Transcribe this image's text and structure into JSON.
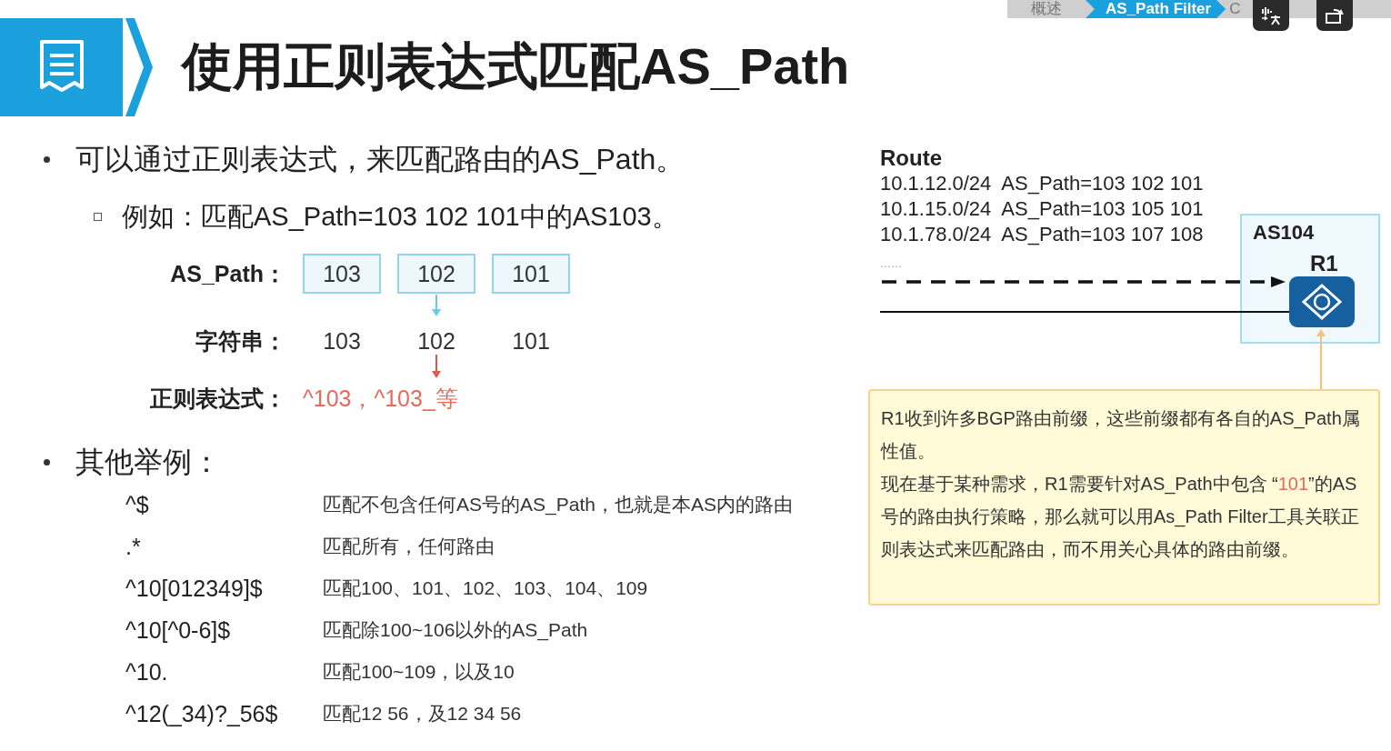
{
  "nav": [
    {
      "label": "概述",
      "selected": false
    },
    {
      "label": "AS_Path Filter",
      "selected": true
    },
    {
      "label": "C",
      "selected": false
    }
  ],
  "title": "使用正则表达式匹配AS_Path",
  "bullet": "可以通过正则表达式，来匹配路由的AS_Path。",
  "sub_bullet": "例如：匹配AS_Path=103 102 101中的AS103。",
  "example": {
    "as_path_label": "AS_Path：",
    "as_path": [
      "103",
      "102",
      "101"
    ],
    "string_label": "字符串：",
    "string": [
      "103",
      "102",
      "101"
    ],
    "regex_label": "正则表达式：",
    "regex": "^103，^103_等"
  },
  "other_bullet": "其他举例：",
  "examples": [
    {
      "pattern": "^$",
      "meaning": "匹配不包含任何AS号的AS_Path，也就是本AS内的路由"
    },
    {
      "pattern": ".*",
      "meaning": "匹配所有，任何路由"
    },
    {
      "pattern": "^10[012349]$",
      "meaning": "匹配100、101、102、103、104、109"
    },
    {
      "pattern": "^10[^0-6]$",
      "meaning": "匹配除100~106以外的AS_Path"
    },
    {
      "pattern": "^10.",
      "meaning": "匹配100~109，以及10"
    },
    {
      "pattern": "^12(_34)?_56$",
      "meaning": "匹配12 56，及12 34 56"
    }
  ],
  "diagram": {
    "route_title": "Route",
    "routes": [
      "10.1.12.0/24  AS_Path=103 102 101",
      "10.1.15.0/24  AS_Path=103 105 101",
      "10.1.78.0/24  AS_Path=103 107 108"
    ],
    "ellipsis": "……",
    "as_label": "AS104",
    "router_label": "R1"
  },
  "note": [
    [
      {
        "text": "R1收到许多BGP路由前缀，这些前缀都有各自的AS_Path属性值。",
        "highlight": false
      }
    ],
    [
      {
        "text": "现在基于某种需求，R1需要针对AS_Path中包含 “",
        "highlight": false
      },
      {
        "text": "101",
        "highlight": true
      },
      {
        "text": "”的AS号的路由执行策略，那么就可以用As_Path Filter工具关联正则表达式来匹配路由，而不用关心具体的路由前缀。",
        "highlight": false
      }
    ]
  ]
}
